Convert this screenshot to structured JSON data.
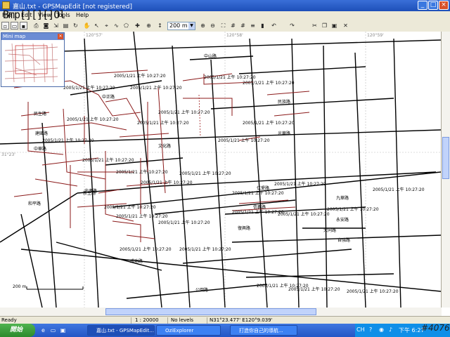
{
  "window": {
    "title": "嘉山.txt - GPSMapEdit [not registered]",
    "minimize": "_",
    "maximize": "□",
    "close": "×"
  },
  "menu": [
    "File",
    "Edit",
    "View",
    "Tools",
    "Help"
  ],
  "toolbar": {
    "zoom_value": "200 m"
  },
  "minimap": {
    "title": "Mini map"
  },
  "map": {
    "coords_top": [
      "120°57'",
      "120°58'",
      "120°59'"
    ],
    "coord_left": "31°23'",
    "scale_label": "200 m",
    "timestamp": "2005/1/21 上午 10:27:20",
    "road_labels": [
      "中山路",
      "中正路",
      "民族路",
      "民生路",
      "光華路",
      "建國路",
      "文化路",
      "和平路",
      "忠孝路",
      "仁愛路",
      "信義路",
      "復興路",
      "九華路",
      "永安路",
      "大同路",
      "自強路",
      "新生路",
      "成功路",
      "公園路",
      "中華路"
    ]
  },
  "status": {
    "ready": "Ready",
    "scale": "1 : 20000",
    "levels": "No levels",
    "coords": "N31°23.477' E120°9.039'"
  },
  "taskbar": {
    "start": "開始",
    "tasks": [
      "嘉山.txt - GPSMapEdit...",
      "OziExplorer",
      "打造你自己的導航..."
    ],
    "tray_lang": "CH",
    "tray_time": "下午 6:27"
  },
  "watermark": {
    "top": "Bmp[][][]Ol",
    "bottom": "#4076"
  }
}
